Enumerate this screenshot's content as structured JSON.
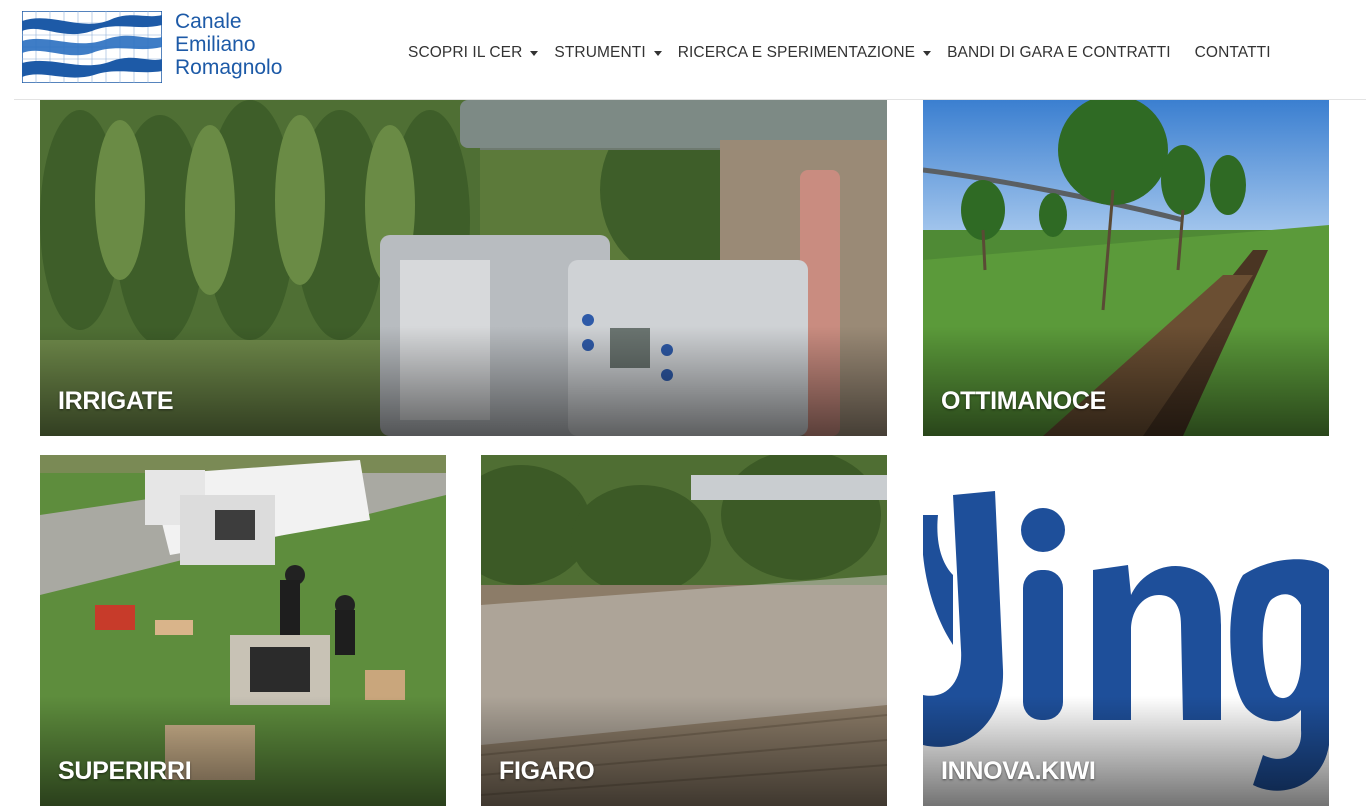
{
  "header": {
    "logo_lines": [
      "Canale",
      "Emiliano",
      "Romagnolo"
    ],
    "brand_color": "#1d5aa7",
    "nav": [
      {
        "label": "SCOPRI IL CER",
        "has_dropdown": true
      },
      {
        "label": "STRUMENTI",
        "has_dropdown": true
      },
      {
        "label": "RICERCA E SPERIMENTAZIONE",
        "has_dropdown": true
      },
      {
        "label": "BANDI DI GARA E CONTRATTI",
        "has_dropdown": false
      },
      {
        "label": "CONTATTI",
        "has_dropdown": false
      }
    ]
  },
  "tiles": [
    {
      "label": "IRRIGATE"
    },
    {
      "label": "OTTIMANOCE"
    },
    {
      "label": "SUPERIRRI"
    },
    {
      "label": "FIGARO"
    },
    {
      "label": "INNOVA.KIWI"
    }
  ]
}
